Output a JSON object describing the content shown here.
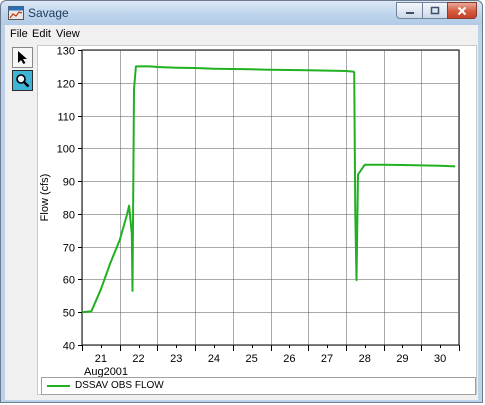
{
  "window": {
    "title": "Savage",
    "accent": "#bcd3eb",
    "controls": {
      "minimize_icon": "minimize-icon",
      "maximize_icon": "maximize-icon",
      "close_icon": "close-icon"
    }
  },
  "menu": {
    "file": "File",
    "edit": "Edit",
    "view": "View"
  },
  "toolbar": {
    "select_icon": "arrow-pointer-icon",
    "zoom_icon": "magnifier-icon"
  },
  "legend": {
    "label": "DSSAV OBS FLOW",
    "color": "#22b022"
  },
  "chart_data": {
    "type": "line",
    "title": "",
    "xlabel": "Aug2001",
    "ylabel": "Flow (cfs)",
    "ylim": [
      40,
      130
    ],
    "yticks": [
      40,
      50,
      60,
      70,
      80,
      90,
      100,
      110,
      120,
      130
    ],
    "xlim": [
      20.5,
      30.5
    ],
    "xtick_labels": [
      "21",
      "22",
      "23",
      "24",
      "25",
      "26",
      "27",
      "28",
      "29",
      "30"
    ],
    "grid": true,
    "line_color": "#22b022",
    "series": [
      {
        "name": "DSSAV OBS FLOW",
        "x": [
          20.5,
          20.75,
          21.0,
          21.25,
          21.5,
          21.7,
          21.75,
          21.82,
          21.84,
          21.88,
          21.93,
          22.3,
          22.5,
          23.0,
          23.5,
          24.0,
          24.5,
          25.0,
          25.5,
          26.0,
          26.5,
          27.0,
          27.5,
          27.7,
          27.72,
          27.75,
          27.78,
          27.82,
          28.0,
          28.5,
          29.0,
          29.5,
          30.0,
          30.4
        ],
        "y": [
          50,
          50.3,
          57,
          65,
          72,
          80,
          82.5,
          74,
          56.5,
          118,
          125,
          125,
          124.8,
          124.6,
          124.5,
          124.3,
          124.2,
          124.1,
          124,
          123.9,
          123.8,
          123.7,
          123.6,
          123.4,
          123.2,
          80,
          59.8,
          92,
          95,
          95,
          94.9,
          94.8,
          94.7,
          94.5
        ]
      }
    ]
  }
}
